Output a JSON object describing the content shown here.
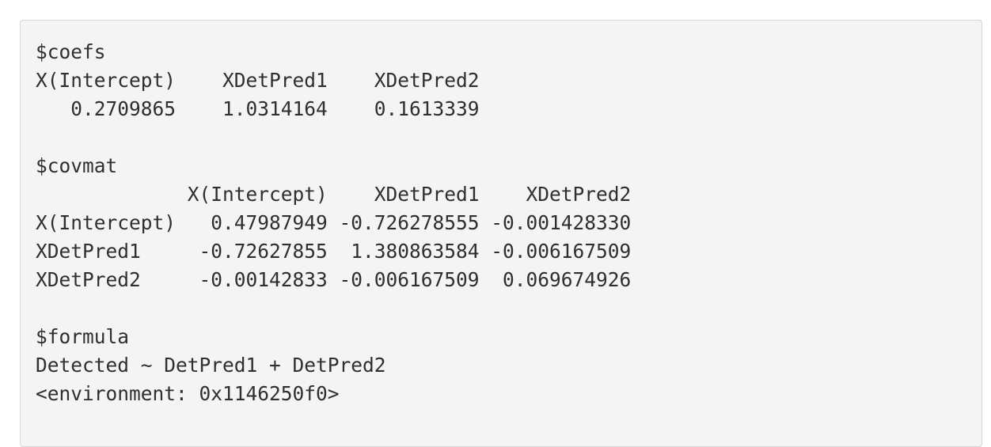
{
  "console_output": {
    "lines": [
      "$coefs",
      "X(Intercept)    XDetPred1    XDetPred2",
      "   0.2709865    1.0314164    0.1613339",
      "",
      "$covmat",
      "             X(Intercept)    XDetPred1    XDetPred2",
      "X(Intercept)   0.47987949 -0.726278555 -0.001428330",
      "XDetPred1     -0.72627855  1.380863584 -0.006167509",
      "XDetPred2     -0.00142833 -0.006167509  0.069674926",
      "",
      "$formula",
      "Detected ~ DetPred1 + DetPred2",
      "<environment: 0x1146250f0>"
    ]
  }
}
